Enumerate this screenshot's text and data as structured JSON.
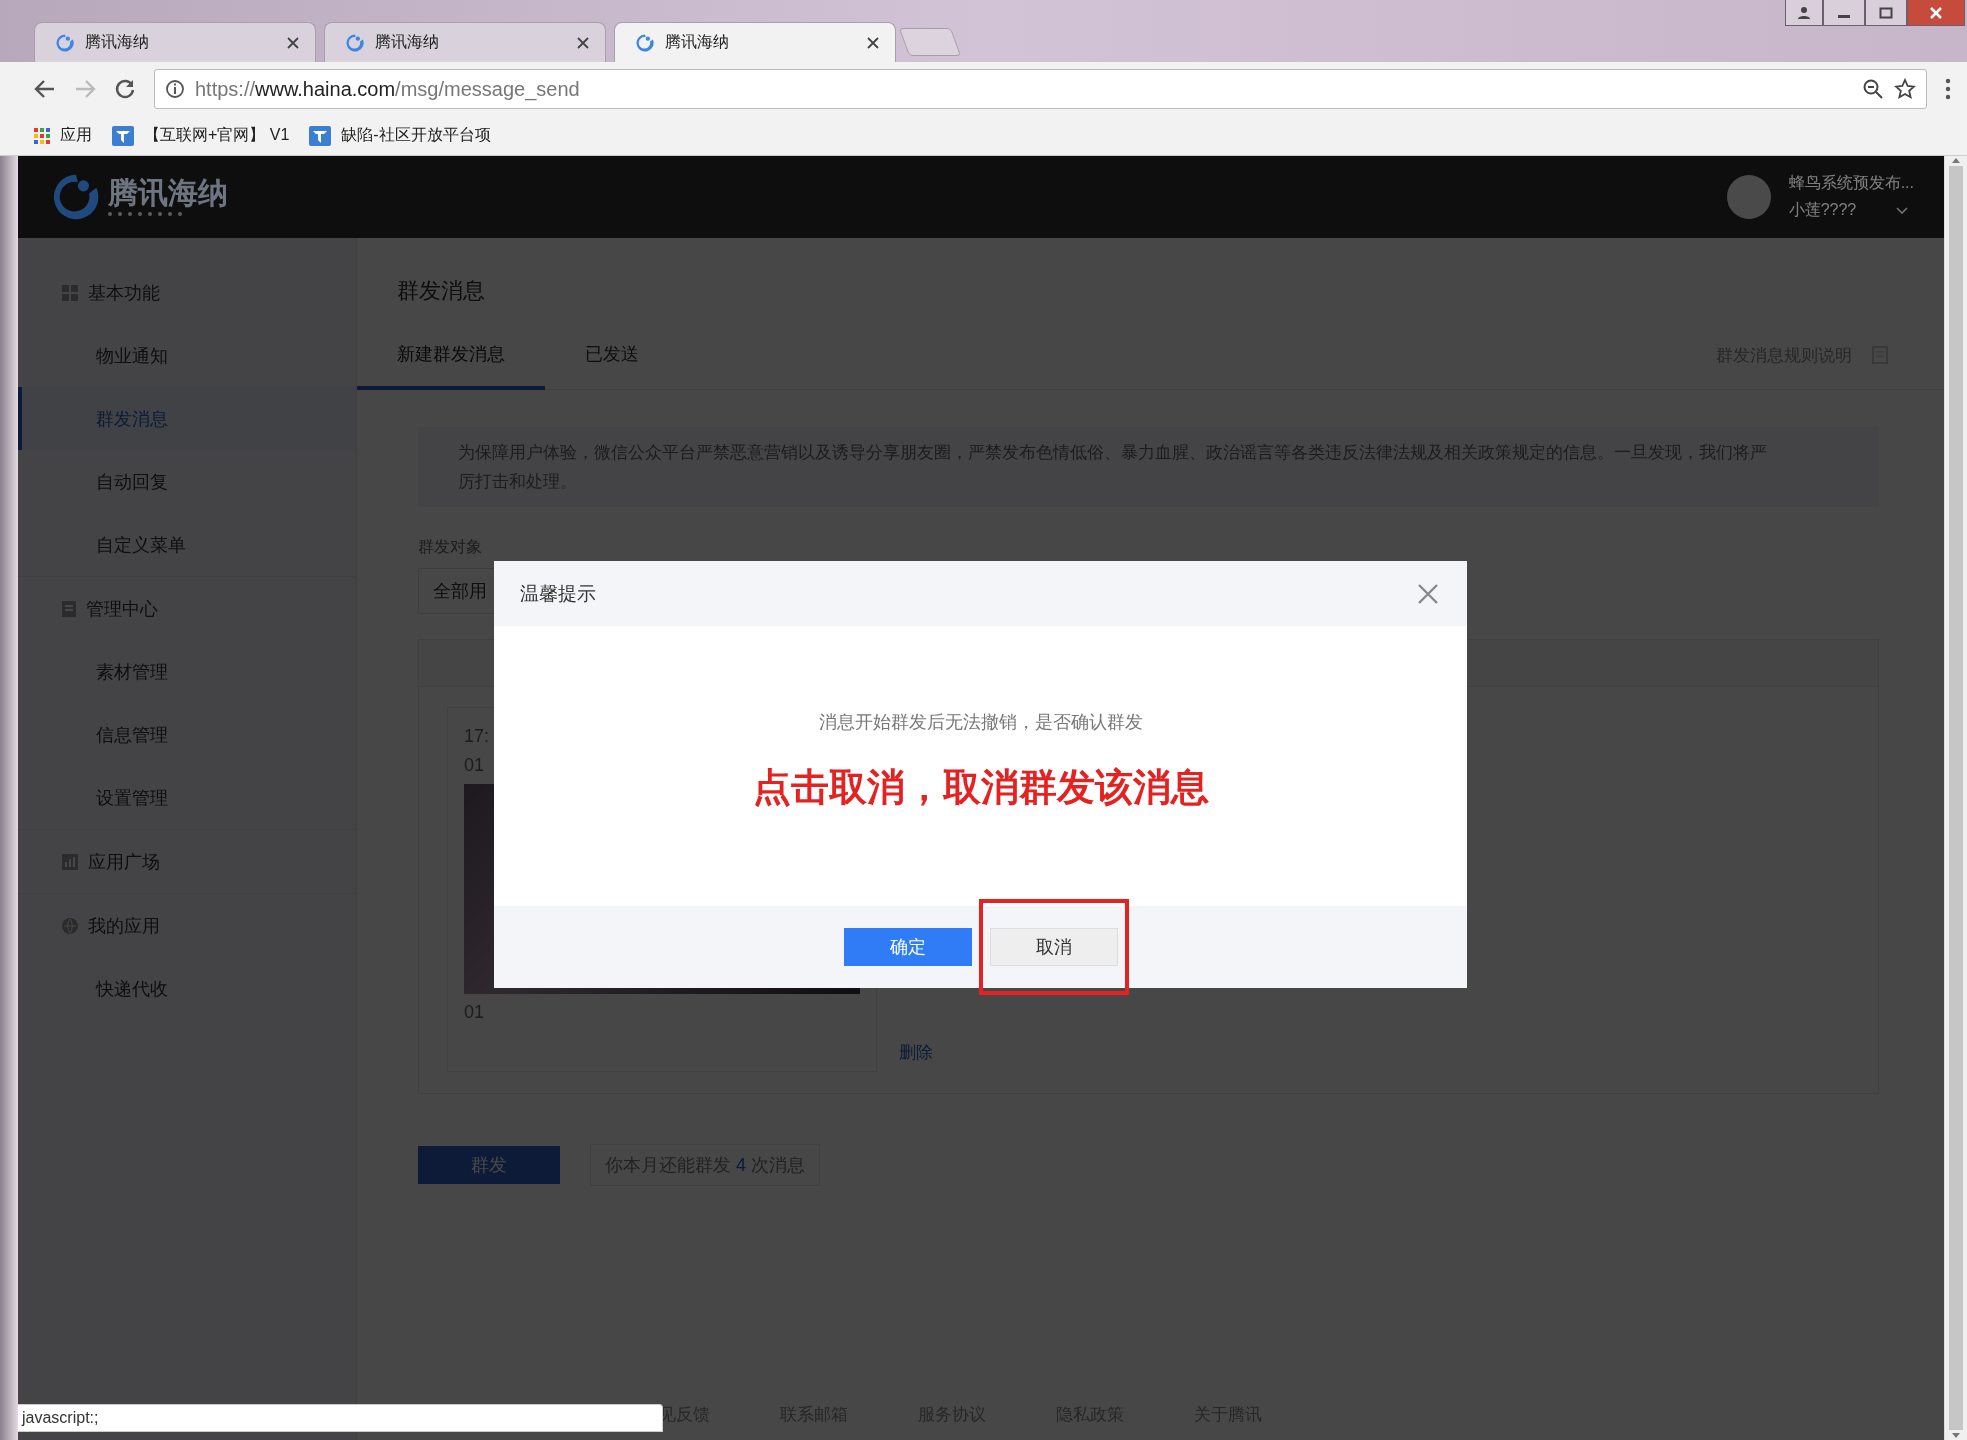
{
  "browser": {
    "tabs": [
      {
        "title": "腾讯海纳",
        "selected": false
      },
      {
        "title": "腾讯海纳",
        "selected": false
      },
      {
        "title": "腾讯海纳",
        "selected": true
      }
    ],
    "url": {
      "scheme": "https://",
      "host": "www.haina.com",
      "path": "/msg/message_send"
    },
    "bookmarks": [
      {
        "label": "应用",
        "kind": "apps"
      },
      {
        "label": "【互联网+官网】 V1",
        "kind": "site"
      },
      {
        "label": "缺陷-社区开放平台项",
        "kind": "site"
      }
    ]
  },
  "header": {
    "logo": "腾讯海纳",
    "notice": "蜂鸟系统预发布...",
    "user": "小莲????"
  },
  "sidebar": {
    "sections": [
      {
        "title": "基本功能",
        "items": [
          {
            "label": "物业通知",
            "selected": false
          },
          {
            "label": "群发消息",
            "selected": true
          },
          {
            "label": "自动回复",
            "selected": false
          },
          {
            "label": "自定义菜单",
            "selected": false
          }
        ]
      },
      {
        "title": "管理中心",
        "items": [
          {
            "label": "素材管理",
            "selected": false
          },
          {
            "label": "信息管理",
            "selected": false
          },
          {
            "label": "设置管理",
            "selected": false
          }
        ]
      },
      {
        "title": "应用广场"
      },
      {
        "title": "我的应用",
        "items": [
          {
            "label": "快递代收",
            "selected": false
          }
        ]
      }
    ]
  },
  "content": {
    "title": "群发消息",
    "tabs": [
      {
        "label": "新建群发消息",
        "selected": true
      },
      {
        "label": "已发送",
        "selected": false
      }
    ],
    "rules_link": "群发消息规则说明",
    "notice": "为保障用户体验，微信公众平台严禁恶意营销以及诱导分享朋友圈，严禁发布色情低俗、暴力血腥、政治谣言等各类违反法律法规及相关政策规定的信息。一旦发现，我们将严厉打击和处理。",
    "target_label": "群发对象",
    "target_value": "全部用",
    "article": {
      "time": "17:",
      "title": "01",
      "caption": "01",
      "delete": "删除"
    },
    "send_button": "群发",
    "quota": "你本月还能群发 **4** 次消息",
    "footer_links": [
      "见反馈",
      "联系邮箱",
      "服务协议",
      "隐私政策",
      "关于腾讯"
    ]
  },
  "dialog": {
    "title": "温馨提示",
    "message": "消息开始群发后无法撤销，是否确认群发",
    "annotation": "点击取消，取消群发该消息",
    "buttons": [
      {
        "label": "确定",
        "kind": "primary",
        "highlighted": false
      },
      {
        "label": "取消",
        "kind": "default",
        "highlighted": true
      }
    ]
  },
  "status_bar": "javascript:;"
}
